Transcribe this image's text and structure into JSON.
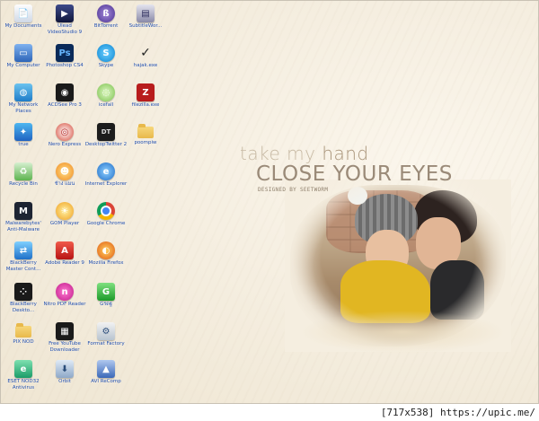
{
  "wallpaper": {
    "tagline_pre": "take my ",
    "tagline_hl": "hand",
    "title": "CLOSE YOUR EYES",
    "credit": "DESIGNED BY SEETWORM"
  },
  "icons": {
    "my_documents": "My Documents",
    "ulead": "Ulead VideoStudio 9",
    "bittorrent": "BitTorrent",
    "subtitleworkshop": "SubtitleWor...",
    "my_computer": "My Computer",
    "photoshop": "Photoshop CS4",
    "skype": "Skype",
    "hajak": "hajak.exe",
    "my_network": "My Network Places",
    "acdsee": "ACDSee Pro 3",
    "icefall": "icefall",
    "filezilla": "filezilla.exe",
    "true": "true",
    "nero_express": "Nero Express",
    "desktoptwitter": "DesktopTwitter 2",
    "poompiw": "poompiw",
    "recycle_bin": "Recycle Bin",
    "thai_app": "ช้าง แมน",
    "ie": "Internet Explorer",
    "malwarebytes": "Malwarebytes' Anti-Malware",
    "gom": "GOM Player",
    "chrome": "Google Chrome",
    "blackberry_manager": "BlackBerry Master Cont...",
    "adobe_reader": "Adobe Reader 9",
    "firefox": "Mozilla Firefox",
    "blackberry_desktop": "BlackBerry Deskto...",
    "nitro": "Nitro PDF Reader",
    "ggg": "Gรดฐ",
    "pix_nod": "PIX NOD",
    "freeyoutube": "Free YouTube Downloader",
    "format_factory": "Format Factory",
    "eset": "ESET NOD32 Antivirus",
    "orbit": "Orbit",
    "avi_recomp": "AVI ReComp"
  },
  "colors": {
    "label": "#1f4ba8"
  },
  "footer": {
    "watermark": "[717x538] https://upic.me/"
  }
}
